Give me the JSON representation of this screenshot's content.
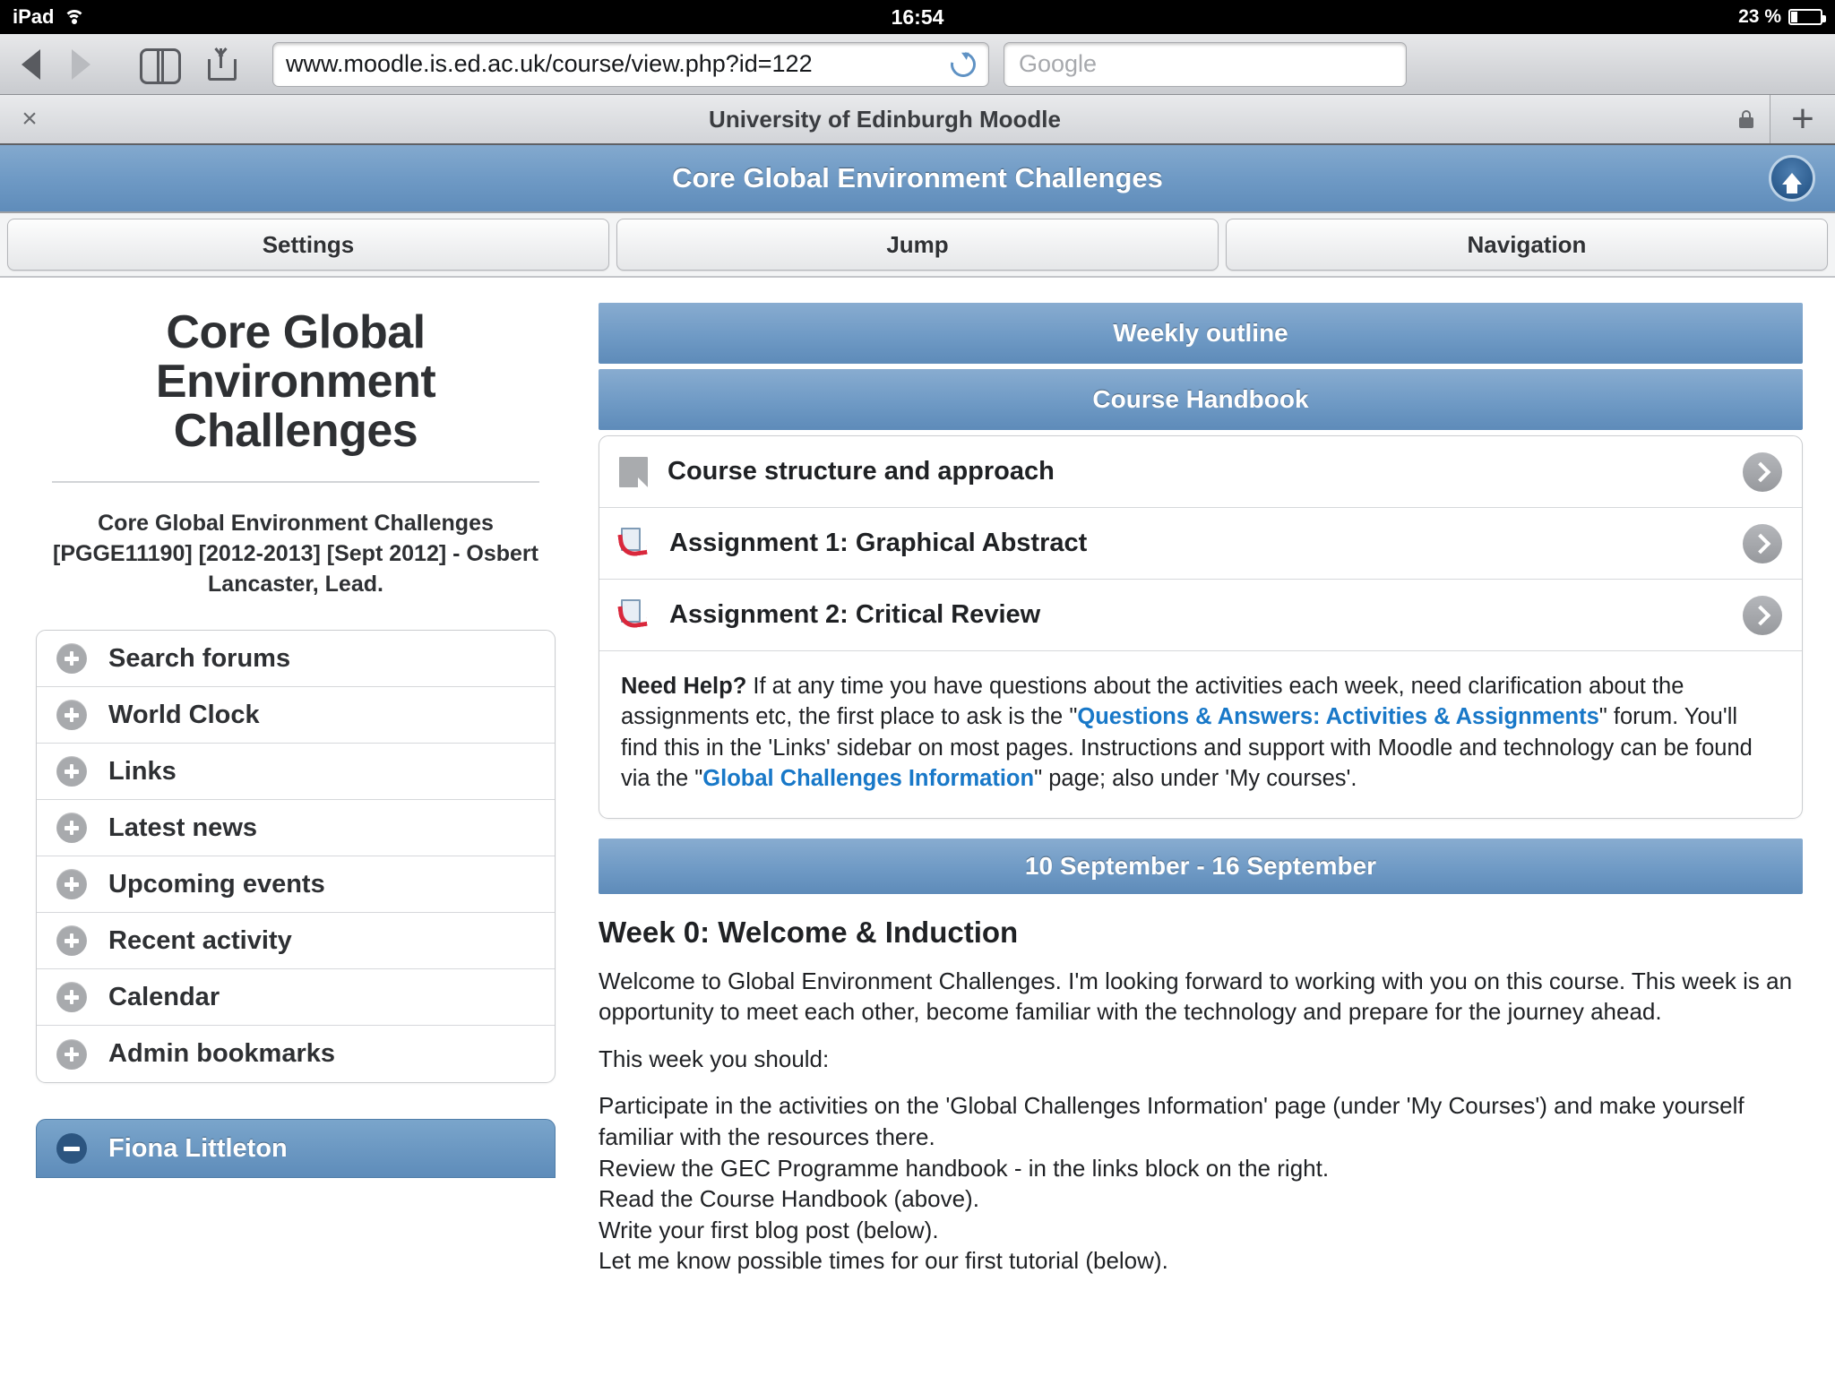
{
  "status_bar": {
    "device": "iPad",
    "wifi_icon": "wifi-icon",
    "time": "16:54",
    "battery_percent": "23 %",
    "battery_icon": "battery-icon"
  },
  "browser": {
    "back_icon": "back-arrow-icon",
    "forward_icon": "forward-arrow-icon",
    "bookmarks_icon": "book-icon",
    "share_icon": "share-icon",
    "url": "www.moodle.is.ed.ac.uk/course/view.php?id=122",
    "reload_icon": "reload-icon",
    "search_placeholder": "Google",
    "tab": {
      "close_icon": "close-icon",
      "title": "University of Edinburgh Moodle",
      "lock_icon": "lock-icon",
      "new_tab_label": "+"
    }
  },
  "moodle_header": {
    "title": "Core Global Environment Challenges",
    "home_icon": "home-icon"
  },
  "nav_buttons": [
    {
      "label": "Settings"
    },
    {
      "label": "Jump"
    },
    {
      "label": "Navigation"
    }
  ],
  "sidebar": {
    "course_title": "Core Global Environment Challenges",
    "course_subtitle": "Core Global Environment Challenges [PGGE11190] [2012-2013] [Sept 2012] - Osbert Lancaster, Lead.",
    "blocks": [
      {
        "label": "Search forums",
        "icon": "plus-icon"
      },
      {
        "label": "World Clock",
        "icon": "plus-icon"
      },
      {
        "label": "Links",
        "icon": "plus-icon"
      },
      {
        "label": "Latest news",
        "icon": "plus-icon"
      },
      {
        "label": "Upcoming events",
        "icon": "plus-icon"
      },
      {
        "label": "Recent activity",
        "icon": "plus-icon"
      },
      {
        "label": "Calendar",
        "icon": "plus-icon"
      },
      {
        "label": "Admin bookmarks",
        "icon": "plus-icon"
      }
    ],
    "user_block": {
      "label": "Fiona Littleton",
      "icon": "minus-icon"
    }
  },
  "main": {
    "weekly_outline_header": "Weekly outline",
    "course_handbook_header": "Course Handbook",
    "activities": [
      {
        "label": "Course structure and approach",
        "icon": "resource-page-icon",
        "chevron": "chevron-right-icon"
      },
      {
        "label": "Assignment 1: Graphical Abstract",
        "icon": "assignment-icon",
        "chevron": "chevron-right-icon"
      },
      {
        "label": "Assignment 2: Critical Review",
        "icon": "assignment-icon",
        "chevron": "chevron-right-icon"
      }
    ],
    "help": {
      "lead": "Need Help?",
      "part1": " If at any time you have questions about the activities each week, need clarification about the assignments etc, the first place to ask is the \"",
      "link1": "Questions & Answers: Activities & Assignments",
      "part2": "\" forum. You'll find this in the 'Links' sidebar on most pages. Instructions and support with Moodle and technology can be found via the \"",
      "link2": "Global Challenges Information",
      "part3": "\" page; also under 'My courses'."
    },
    "date_header": "10 September - 16 September",
    "week_title": "Week 0: Welcome & Induction",
    "week_intro": "Welcome to Global Environment Challenges. I'm looking forward to working with you on this course. This week is an opportunity to meet each other, become familiar with the technology and prepare for the journey ahead.",
    "week_prompt": "This week you should:",
    "week_tasks": [
      "Participate in the activities on the 'Global Challenges Information' page (under 'My Courses') and make yourself familiar with the resources there.",
      "Review the GEC Programme handbook - in the links block on the right.",
      "Read the Course Handbook (above).",
      "Write your first blog post (below).",
      "Let me know possible times for our first tutorial (below)."
    ]
  },
  "colors": {
    "moodle_blue": "#6f9ac5",
    "link_blue": "#1878c8",
    "text_dark": "#1f2124"
  }
}
